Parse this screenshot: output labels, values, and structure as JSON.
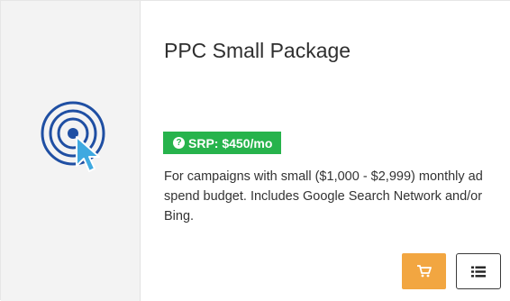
{
  "product": {
    "title": "PPC Small Package",
    "srp_label": "SRP: $450/mo",
    "description": "For campaigns with small ($1,000 - $2,999) monthly ad spend budget. Includes Google Search Network and/or Bing."
  },
  "icons": {
    "product": "target-cursor-icon",
    "srp_help": "question-circle-icon",
    "cart": "shopping-cart-icon",
    "details": "list-icon"
  },
  "colors": {
    "icon_panel_bg": "#f3f3f3",
    "target_blue": "#1f4fa3",
    "cursor_blue": "#3fa9e0",
    "srp_green": "#27b34c",
    "cart_orange": "#f2a641"
  }
}
